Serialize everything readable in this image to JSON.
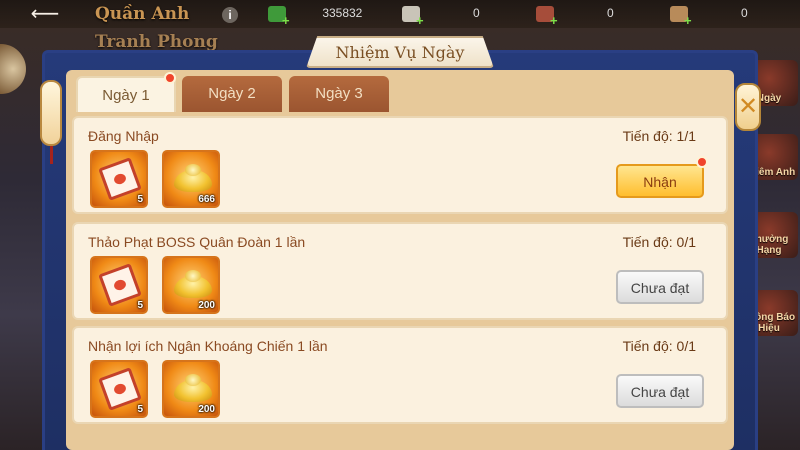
{
  "topbar": {
    "back_label": "⟵",
    "title": "Quần Anh",
    "subtitle": "Tranh Phong",
    "info_label": "i",
    "resources": [
      {
        "value": "335832",
        "icon": "jade-icon",
        "color": "#3f9a3a"
      },
      {
        "value": "0",
        "icon": "scroll-icon",
        "color": "#c9c4b8"
      },
      {
        "value": "0",
        "icon": "scroll-red-icon",
        "color": "#a64d3a"
      },
      {
        "value": "0",
        "icon": "ticket-icon",
        "color": "#b88b5a"
      }
    ]
  },
  "side": {
    "items": [
      {
        "label": "Ngày"
      },
      {
        "label": "Chiêm Anh"
      },
      {
        "label": "Thưởng Hạng"
      },
      {
        "label": "Thông Báo Hiệu"
      }
    ]
  },
  "panel": {
    "title": "Nhiệm Vụ Ngày",
    "close_label": "✕"
  },
  "tabs": [
    {
      "label": "Ngày 1",
      "active": true,
      "has_dot": true
    },
    {
      "label": "Ngày 2",
      "active": false,
      "has_dot": false
    },
    {
      "label": "Ngày 3",
      "active": false,
      "has_dot": false
    }
  ],
  "tasks": [
    {
      "title": "Đăng Nhập",
      "progress": "Tiến độ: 1/1",
      "rewards": [
        {
          "type": "scroll",
          "count": "5"
        },
        {
          "type": "ingot",
          "count": "666"
        }
      ],
      "button": "Nhận",
      "state": "claimable"
    },
    {
      "title": "Thảo Phạt BOSS Quân Đoàn 1 lần",
      "progress": "Tiến độ: 0/1",
      "rewards": [
        {
          "type": "scroll",
          "count": "5"
        },
        {
          "type": "ingot",
          "count": "200"
        }
      ],
      "button": "Chưa đạt",
      "state": "incomplete"
    },
    {
      "title": "Nhận lợi ích Ngân Khoáng Chiến 1 lần",
      "progress": "Tiến độ: 0/1",
      "rewards": [
        {
          "type": "scroll",
          "count": "5"
        },
        {
          "type": "ingot",
          "count": "200"
        }
      ],
      "button": "Chưa đạt",
      "state": "incomplete"
    }
  ]
}
